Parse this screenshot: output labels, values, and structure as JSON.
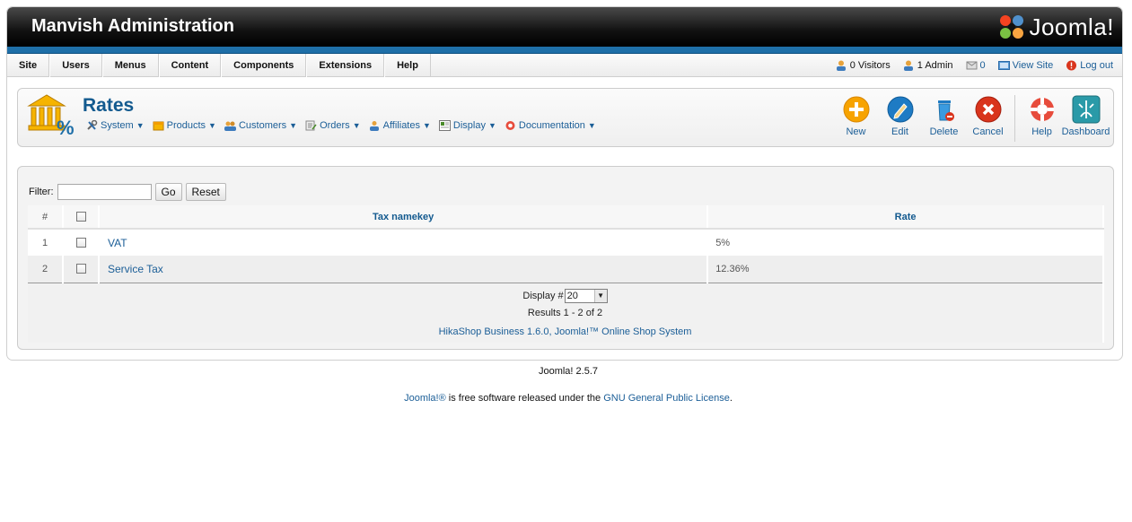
{
  "header": {
    "title": "Manvish Administration",
    "logo_text": "Joomla!"
  },
  "menu": [
    "Site",
    "Users",
    "Menus",
    "Content",
    "Components",
    "Extensions",
    "Help"
  ],
  "status": {
    "visitors": "0 Visitors",
    "admins": "1 Admin",
    "messages": "0",
    "view_site": "View Site",
    "logout": "Log out"
  },
  "toolbar": {
    "page_title": "Rates",
    "submenu": [
      "System",
      "Products",
      "Customers",
      "Orders",
      "Affiliates",
      "Display",
      "Documentation"
    ],
    "buttons": {
      "new": "New",
      "edit": "Edit",
      "delete": "Delete",
      "cancel": "Cancel",
      "help": "Help",
      "dashboard": "Dashboard"
    }
  },
  "filter": {
    "label": "Filter:",
    "value": "",
    "go": "Go",
    "reset": "Reset"
  },
  "table": {
    "headers": {
      "num": "#",
      "namekey": "Tax namekey",
      "rate": "Rate"
    },
    "rows": [
      {
        "num": "1",
        "namekey": "VAT",
        "rate": "5%"
      },
      {
        "num": "2",
        "namekey": "Service Tax",
        "rate": "12.36%"
      }
    ],
    "display_label": "Display #",
    "display_value": "20",
    "results": "Results 1 - 2 of 2",
    "powered": "HikaShop Business 1.6.0, Joomla!™ Online Shop System"
  },
  "footer": {
    "version": "Joomla! 2.5.7",
    "joomla_link": "Joomla!®",
    "license_text": " is free software released under the ",
    "license_link": "GNU General Public License",
    "period": "."
  },
  "colors": {
    "brand_blue": "#1e6fa8",
    "link": "#1b5e97",
    "title": "#135a8f"
  }
}
